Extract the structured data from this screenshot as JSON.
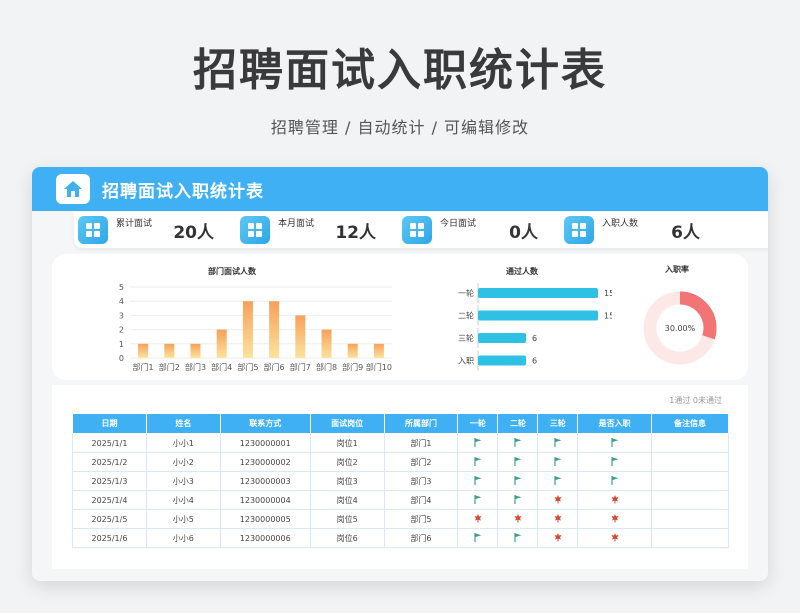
{
  "page": {
    "title": "招聘面试入职统计表",
    "subtitle": "招聘管理 / 自动统计 / 可编辑修改"
  },
  "card": {
    "title": "招聘面试入职统计表",
    "icon": "home-icon"
  },
  "kpis": [
    {
      "label": "累计面试",
      "value": "20人"
    },
    {
      "label": "本月面试",
      "value": "12人"
    },
    {
      "label": "今日面试",
      "value": "0人"
    },
    {
      "label": "入职人数",
      "value": "6人"
    }
  ],
  "colors": {
    "accent": "#3fb0f3",
    "bar_top": "#f6a05a",
    "bar_bottom": "#fde39e",
    "hbar": "#2fc1e3",
    "donut": "#f27474",
    "donut_track": "#fde8e8",
    "flag_pass": "#3f9e8a",
    "flag_fail": "#d9452e"
  },
  "chart_data": [
    {
      "type": "bar",
      "title": "部门面试人数",
      "categories": [
        "部门1",
        "部门2",
        "部门3",
        "部门4",
        "部门5",
        "部门6",
        "部门7",
        "部门8",
        "部门9",
        "部门10"
      ],
      "values": [
        1,
        1,
        1,
        2,
        4,
        4,
        3,
        2,
        1,
        1
      ],
      "yticks": [
        "0",
        "1",
        "2",
        "3",
        "4",
        "5"
      ],
      "ylim": [
        0,
        5
      ],
      "grid": true
    },
    {
      "type": "bar",
      "orientation": "horizontal",
      "title": "通过人数",
      "categories": [
        "一轮",
        "二轮",
        "三轮",
        "入职"
      ],
      "values": [
        15,
        15,
        6,
        6
      ],
      "value_labels": [
        "15",
        "15",
        "6",
        "6"
      ],
      "xlim": [
        0,
        15
      ]
    },
    {
      "type": "pie",
      "title": "入职率",
      "values": [
        30,
        70
      ],
      "center_label": "30.00%"
    }
  ],
  "table": {
    "legend": "1通过  0未通过",
    "headers": [
      "日期",
      "姓名",
      "联系方式",
      "面试岗位",
      "所属部门",
      "一轮",
      "二轮",
      "三轮",
      "是否入职",
      "备注信息"
    ],
    "rows": [
      {
        "date": "2025/1/1",
        "name": "小小1",
        "phone": "1230000001",
        "post": "岗位1",
        "dept": "部门1",
        "r1": "pass",
        "r2": "pass",
        "r3": "pass",
        "hired": "pass",
        "note": ""
      },
      {
        "date": "2025/1/2",
        "name": "小小2",
        "phone": "1230000002",
        "post": "岗位2",
        "dept": "部门2",
        "r1": "pass",
        "r2": "pass",
        "r3": "pass",
        "hired": "pass",
        "note": ""
      },
      {
        "date": "2025/1/3",
        "name": "小小3",
        "phone": "1230000003",
        "post": "岗位3",
        "dept": "部门3",
        "r1": "pass",
        "r2": "pass",
        "r3": "pass",
        "hired": "pass",
        "note": ""
      },
      {
        "date": "2025/1/4",
        "name": "小小4",
        "phone": "1230000004",
        "post": "岗位4",
        "dept": "部门4",
        "r1": "pass",
        "r2": "pass",
        "r3": "fail",
        "hired": "fail",
        "note": ""
      },
      {
        "date": "2025/1/5",
        "name": "小小5",
        "phone": "1230000005",
        "post": "岗位5",
        "dept": "部门5",
        "r1": "fail",
        "r2": "fail",
        "r3": "fail",
        "hired": "fail",
        "note": ""
      },
      {
        "date": "2025/1/6",
        "name": "小小6",
        "phone": "1230000006",
        "post": "岗位6",
        "dept": "部门6",
        "r1": "pass",
        "r2": "pass",
        "r3": "fail",
        "hired": "fail",
        "note": ""
      }
    ]
  }
}
